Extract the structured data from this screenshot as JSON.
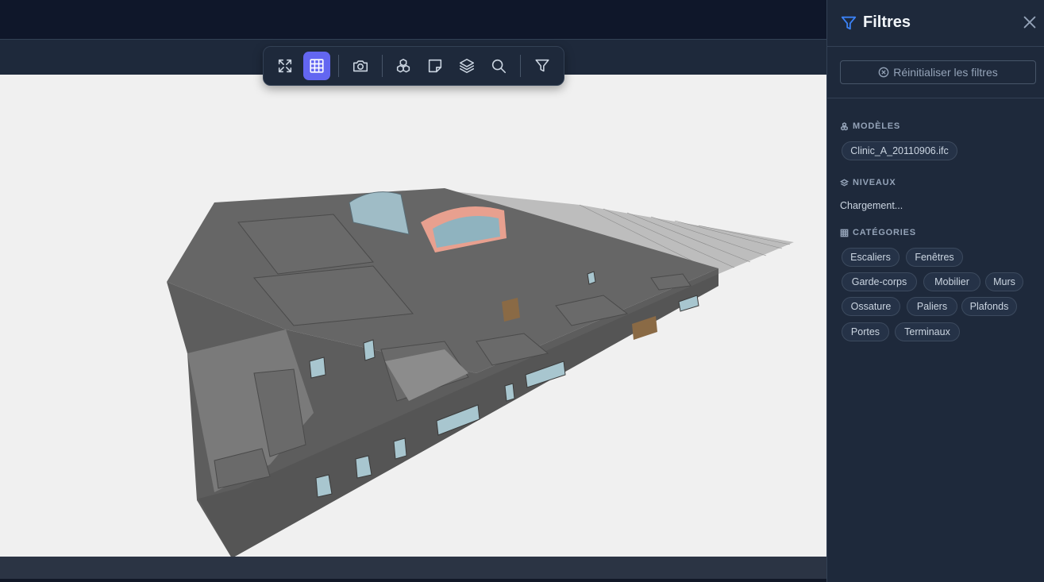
{
  "toolbar": {
    "buttons": [
      {
        "name": "fullscreen",
        "icon": "expand-icon"
      },
      {
        "name": "grid",
        "icon": "grid-icon",
        "active": true
      },
      {
        "name": "screenshot",
        "icon": "camera-icon"
      },
      {
        "name": "models",
        "icon": "cubes-icon"
      },
      {
        "name": "notes",
        "icon": "note-icon"
      },
      {
        "name": "layers",
        "icon": "layers-icon"
      },
      {
        "name": "search",
        "icon": "search-icon"
      },
      {
        "name": "filter",
        "icon": "filter-icon"
      }
    ],
    "active_color": "#6366f1"
  },
  "panel": {
    "title": "Filtres",
    "reset_label": "Réinitialiser les filtres",
    "sections": {
      "models": {
        "label": "MODÈLES",
        "items": [
          "Clinic_A_20110906.ifc"
        ]
      },
      "levels": {
        "label": "NIVEAUX",
        "status": "Chargement..."
      },
      "categories": {
        "label": "CATÉGORIES",
        "items": [
          "Escaliers",
          "Fenêtres",
          "Garde-corps",
          "Mobilier",
          "Murs",
          "Ossature",
          "Paliers",
          "Plafonds",
          "Portes",
          "Terminaux"
        ]
      }
    },
    "accent_color": "#3b82f6"
  },
  "viewport": {
    "background": "#f0f0f0",
    "model_color": "#6e6e6e"
  }
}
